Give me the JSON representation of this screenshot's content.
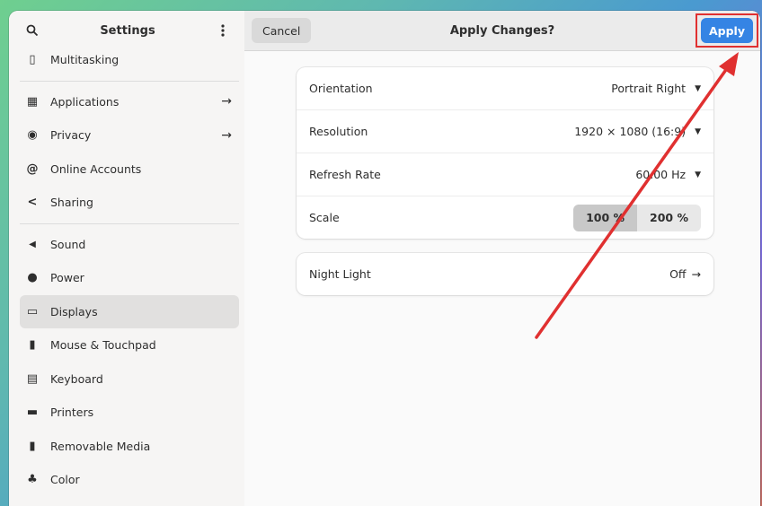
{
  "sidebar": {
    "title": "Settings",
    "search_icon": "search-icon",
    "menu_icon": "kebab-menu-icon",
    "items": [
      {
        "label": "Multitasking",
        "icon": "multitasking-icon",
        "glyph": "▯",
        "arrow": ""
      },
      {
        "label": "Applications",
        "icon": "applications-icon",
        "glyph": "▦",
        "arrow": "→"
      },
      {
        "label": "Privacy",
        "icon": "privacy-icon",
        "glyph": "◉",
        "arrow": "→"
      },
      {
        "label": "Online Accounts",
        "icon": "at-icon",
        "glyph": "@",
        "arrow": ""
      },
      {
        "label": "Sharing",
        "icon": "share-icon",
        "glyph": "<",
        "arrow": ""
      },
      {
        "label": "Sound",
        "icon": "speaker-icon",
        "glyph": "◀",
        "arrow": ""
      },
      {
        "label": "Power",
        "icon": "power-icon",
        "glyph": "●",
        "arrow": ""
      },
      {
        "label": "Displays",
        "icon": "display-icon",
        "glyph": "▭",
        "arrow": ""
      },
      {
        "label": "Mouse & Touchpad",
        "icon": "mouse-icon",
        "glyph": "▮",
        "arrow": ""
      },
      {
        "label": "Keyboard",
        "icon": "keyboard-icon",
        "glyph": "▤",
        "arrow": ""
      },
      {
        "label": "Printers",
        "icon": "printer-icon",
        "glyph": "▬",
        "arrow": ""
      },
      {
        "label": "Removable Media",
        "icon": "usb-icon",
        "glyph": "▮",
        "arrow": ""
      },
      {
        "label": "Color",
        "icon": "color-icon",
        "glyph": "♣",
        "arrow": ""
      }
    ]
  },
  "header": {
    "cancel_label": "Cancel",
    "title": "Apply Changes?",
    "apply_label": "Apply"
  },
  "display_settings": {
    "orientation": {
      "label": "Orientation",
      "value": "Portrait Right"
    },
    "resolution": {
      "label": "Resolution",
      "value": "1920 × 1080 (16:9)"
    },
    "refresh_rate": {
      "label": "Refresh Rate",
      "value": "60.00 Hz"
    },
    "scale": {
      "label": "Scale",
      "options": [
        "100 %",
        "200 %"
      ],
      "selected": "100 %"
    }
  },
  "night_light": {
    "label": "Night Light",
    "value": "Off",
    "arrow": "→"
  },
  "colors": {
    "accent": "#3584e4",
    "annotation": "#e03030"
  }
}
